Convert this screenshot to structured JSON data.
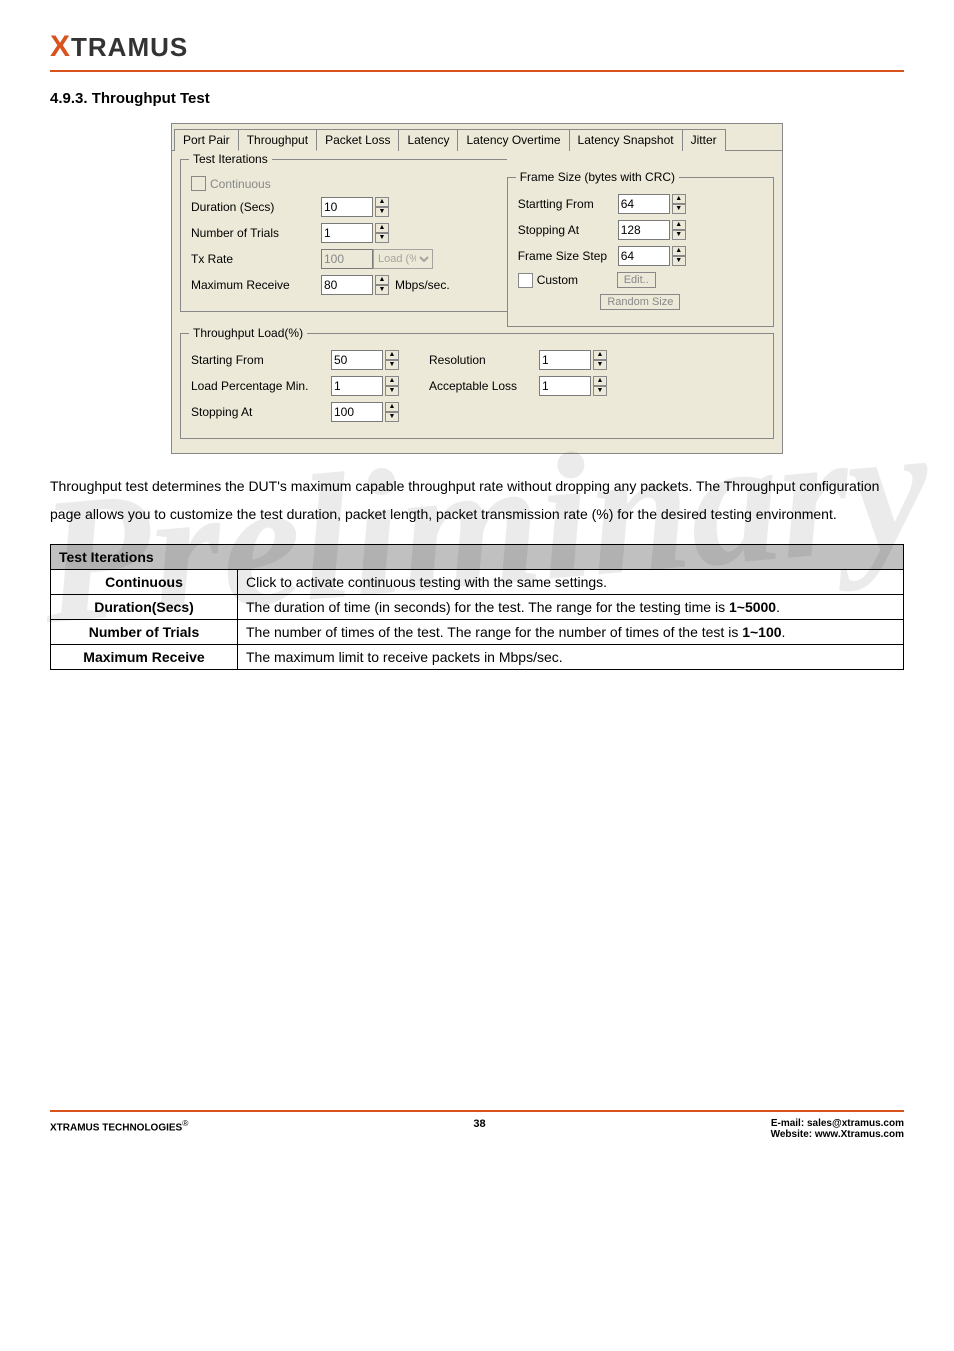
{
  "logo": {
    "x": "X",
    "rest": "TRAMUS"
  },
  "section_title": "4.9.3. Throughput Test",
  "tabs": [
    "Port Pair",
    "Throughput",
    "Packet Loss",
    "Latency",
    "Latency Overtime",
    "Latency Snapshot",
    "Jitter"
  ],
  "active_tab_index": 1,
  "groups": {
    "test_iterations": {
      "legend": "Test Iterations",
      "continuous": "Continuous",
      "duration_label": "Duration (Secs)",
      "duration_value": "10",
      "trials_label": "Number of Trials",
      "trials_value": "1",
      "txrate_label": "Tx Rate",
      "txrate_value": "100",
      "txrate_unit": "Load (%)",
      "maxrecv_label": "Maximum Receive",
      "maxrecv_value": "80",
      "maxrecv_unit": "Mbps/sec."
    },
    "frame_size": {
      "legend": "Frame Size (bytes with CRC)",
      "start_label": "Startting From",
      "start_value": "64",
      "stop_label": "Stopping At",
      "stop_value": "128",
      "step_label": "Frame Size Step",
      "step_value": "64",
      "custom_label": "Custom",
      "edit_btn": "Edit..",
      "random_btn": "Random Size"
    },
    "throughput_load": {
      "legend": "Throughput Load(%)",
      "start_label": "Starting From",
      "start_value": "50",
      "res_label": "Resolution",
      "res_value": "1",
      "min_label": "Load Percentage Min.",
      "min_value": "1",
      "loss_label": "Acceptable Loss",
      "loss_value": "1",
      "stop_label": "Stopping At",
      "stop_value": "100"
    }
  },
  "description": "Throughput test determines the DUT's maximum capable throughput rate without dropping any packets. The Throughput configuration page allows you to customize the test duration, packet length, packet transmission rate (%) for the desired testing environment.",
  "table": {
    "header": "Test Iterations",
    "rows": [
      {
        "label": "Continuous",
        "desc": "Click to activate continuous testing with the same settings."
      },
      {
        "label": "Duration(Secs)",
        "desc": "The duration of time (in seconds) for the test. The range for the testing time is <b>1~5000</b>."
      },
      {
        "label": "Number of Trials",
        "desc": "The number of times of the test. The range for the number of times of the test is <b>1~100</b>."
      },
      {
        "label": "Maximum Receive",
        "desc": "The maximum limit to receive packets in Mbps/sec."
      }
    ]
  },
  "watermark": "Preliminary",
  "footer": {
    "left": "XTRAMUS TECHNOLOGIES",
    "reg": "®",
    "page": "38",
    "email_label": "E-mail:",
    "email": "sales@xtramus.com",
    "web_label": "Website:",
    "web": "www.Xtramus.com"
  }
}
